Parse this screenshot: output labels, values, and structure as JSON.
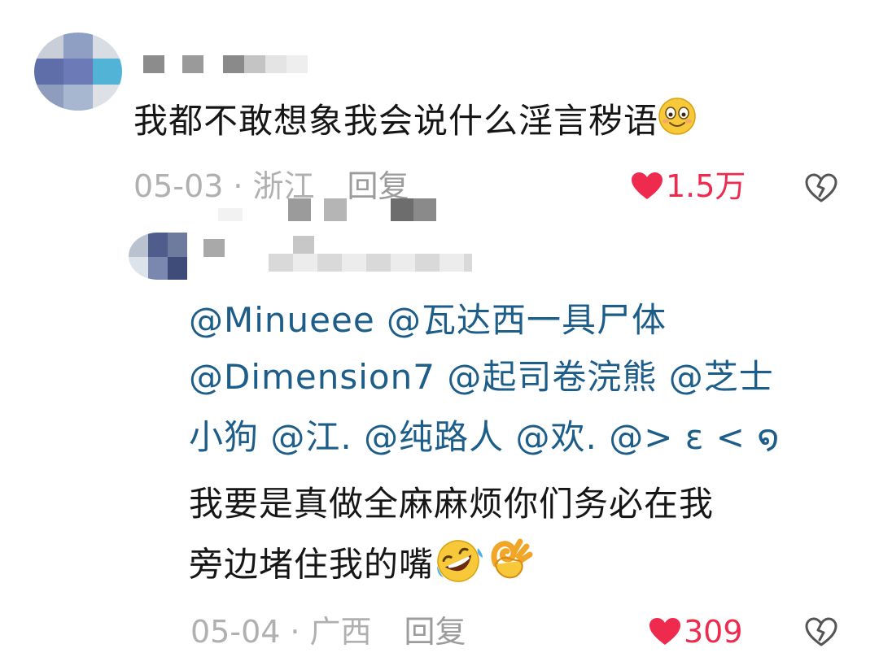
{
  "comments": [
    {
      "text": "我都不敢想象我会说什么淫言秽语",
      "date": "05-03",
      "separator": "·",
      "location": "浙江",
      "reply_label": "回复",
      "likes": "1.5万",
      "emoji": "smiling-face-with-happy-eyes"
    }
  ],
  "reply": {
    "mention_lines": [
      [
        "@Minueee",
        "@瓦达西一具尸体"
      ],
      [
        "@Dimension7",
        "@起司卷浣熊",
        "@芝士"
      ],
      [
        "小狗",
        "@江.",
        "@纯路人",
        "@欢.",
        "@> ε < ໑"
      ]
    ],
    "body_lines": [
      "我要是真做全麻麻烦你们务必在我",
      "旁边堵住我的嘴"
    ],
    "date": "05-04",
    "separator": "·",
    "location": "广西",
    "reply_label": "回复",
    "likes": "309",
    "emojis": [
      "rolling-on-floor-laughing",
      "ok-hand"
    ]
  },
  "colors": {
    "mention": "#1d5d8a",
    "like": "#ef2a4f",
    "meta": "#b0b0b0"
  }
}
